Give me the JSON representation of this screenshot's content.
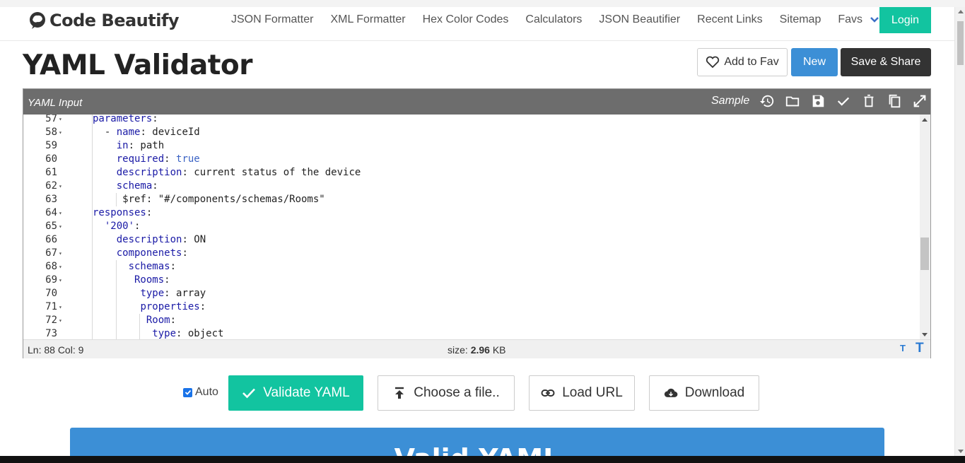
{
  "brand": {
    "name": "Code Beautify"
  },
  "nav": {
    "items": [
      "JSON Formatter",
      "XML Formatter",
      "Hex Color Codes",
      "Calculators",
      "JSON Beautifier",
      "Recent Links",
      "Sitemap"
    ],
    "favs": "Favs",
    "login": "Login"
  },
  "page": {
    "title": "YAML Validator",
    "add_fav": "Add to Fav",
    "new": "New",
    "save_share": "Save & Share"
  },
  "editor": {
    "label": "YAML Input",
    "sample": "Sample",
    "tools": [
      "history-icon",
      "folder-icon",
      "save-icon",
      "check-icon",
      "trash-icon",
      "copy-icon",
      "expand-icon"
    ],
    "lines": [
      {
        "n": "57",
        "fold": true,
        "indent": 6,
        "tokens": [
          [
            "k",
            "parameters"
          ],
          [
            "s",
            ":"
          ]
        ]
      },
      {
        "n": "58",
        "fold": true,
        "indent": 8,
        "tokens": [
          [
            "s",
            "- "
          ],
          [
            "k",
            "name"
          ],
          [
            "s",
            ": deviceId"
          ]
        ]
      },
      {
        "n": "59",
        "fold": false,
        "indent": 10,
        "tokens": [
          [
            "k",
            "in"
          ],
          [
            "s",
            ": path"
          ]
        ]
      },
      {
        "n": "60",
        "fold": false,
        "indent": 10,
        "tokens": [
          [
            "k",
            "required"
          ],
          [
            "s",
            ": "
          ],
          [
            "b",
            "true"
          ]
        ]
      },
      {
        "n": "61",
        "fold": false,
        "indent": 10,
        "tokens": [
          [
            "k",
            "description"
          ],
          [
            "s",
            ": current status of the device"
          ]
        ]
      },
      {
        "n": "62",
        "fold": true,
        "indent": 10,
        "tokens": [
          [
            "k",
            "schema"
          ],
          [
            "s",
            ":"
          ]
        ]
      },
      {
        "n": "63",
        "fold": false,
        "indent": 11,
        "tokens": [
          [
            "s",
            "$ref: \"#/components/schemas/Rooms\""
          ]
        ]
      },
      {
        "n": "64",
        "fold": true,
        "indent": 6,
        "tokens": [
          [
            "k",
            "responses"
          ],
          [
            "s",
            ":"
          ]
        ]
      },
      {
        "n": "65",
        "fold": true,
        "indent": 8,
        "tokens": [
          [
            "k",
            "'200'"
          ],
          [
            "s",
            ":"
          ]
        ]
      },
      {
        "n": "66",
        "fold": false,
        "indent": 10,
        "tokens": [
          [
            "k",
            "description"
          ],
          [
            "s",
            ": ON"
          ]
        ]
      },
      {
        "n": "67",
        "fold": true,
        "indent": 10,
        "tokens": [
          [
            "k",
            "componenets"
          ],
          [
            "s",
            ":"
          ]
        ]
      },
      {
        "n": "68",
        "fold": true,
        "indent": 12,
        "tokens": [
          [
            "k",
            "schemas"
          ],
          [
            "s",
            ":"
          ]
        ]
      },
      {
        "n": "69",
        "fold": true,
        "indent": 13,
        "tokens": [
          [
            "k",
            "Rooms"
          ],
          [
            "s",
            ":"
          ]
        ]
      },
      {
        "n": "70",
        "fold": false,
        "indent": 14,
        "tokens": [
          [
            "k",
            "type"
          ],
          [
            "s",
            ": array"
          ]
        ]
      },
      {
        "n": "71",
        "fold": true,
        "indent": 14,
        "tokens": [
          [
            "k",
            "properties"
          ],
          [
            "s",
            ":"
          ]
        ]
      },
      {
        "n": "72",
        "fold": true,
        "indent": 15,
        "tokens": [
          [
            "k",
            "Room"
          ],
          [
            "s",
            ":"
          ]
        ]
      },
      {
        "n": "73",
        "fold": false,
        "indent": 16,
        "tokens": [
          [
            "k",
            "type"
          ],
          [
            "s",
            ": object"
          ]
        ]
      }
    ],
    "status_pos": "Ln: 88 Col: 9",
    "size_label": "size: ",
    "size_value": "2.96",
    "size_unit": " KB"
  },
  "actions": {
    "auto": "Auto",
    "auto_checked": true,
    "validate": "Validate YAML",
    "choose": "Choose a file..",
    "load_url": "Load URL",
    "download": "Download"
  },
  "result": {
    "text": "Valid YAML"
  },
  "colors": {
    "accent": "#12c4a0",
    "primary": "#3c8fd6",
    "toolbar": "#6d6d6d",
    "dark": "#333333"
  }
}
